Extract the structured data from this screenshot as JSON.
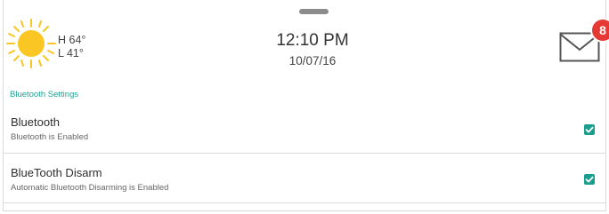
{
  "header": {
    "weather": {
      "icon": "sun-icon",
      "high": "H 64°",
      "low": "L 41°"
    },
    "time": "12:10 PM",
    "date": "10/07/16",
    "messages": {
      "icon": "mail-icon",
      "count": "8"
    }
  },
  "settings": {
    "section_title": "Bluetooth Settings",
    "items": [
      {
        "title": "Bluetooth",
        "subtitle": "Bluetooth is Enabled",
        "checked": true
      },
      {
        "title": "BlueTooth Disarm",
        "subtitle": "Automatic Bluetooth Disarming is Enabled",
        "checked": true
      }
    ]
  },
  "colors": {
    "accent": "#1b9e8e",
    "badge": "#e53935",
    "sun": "#f9c623"
  }
}
